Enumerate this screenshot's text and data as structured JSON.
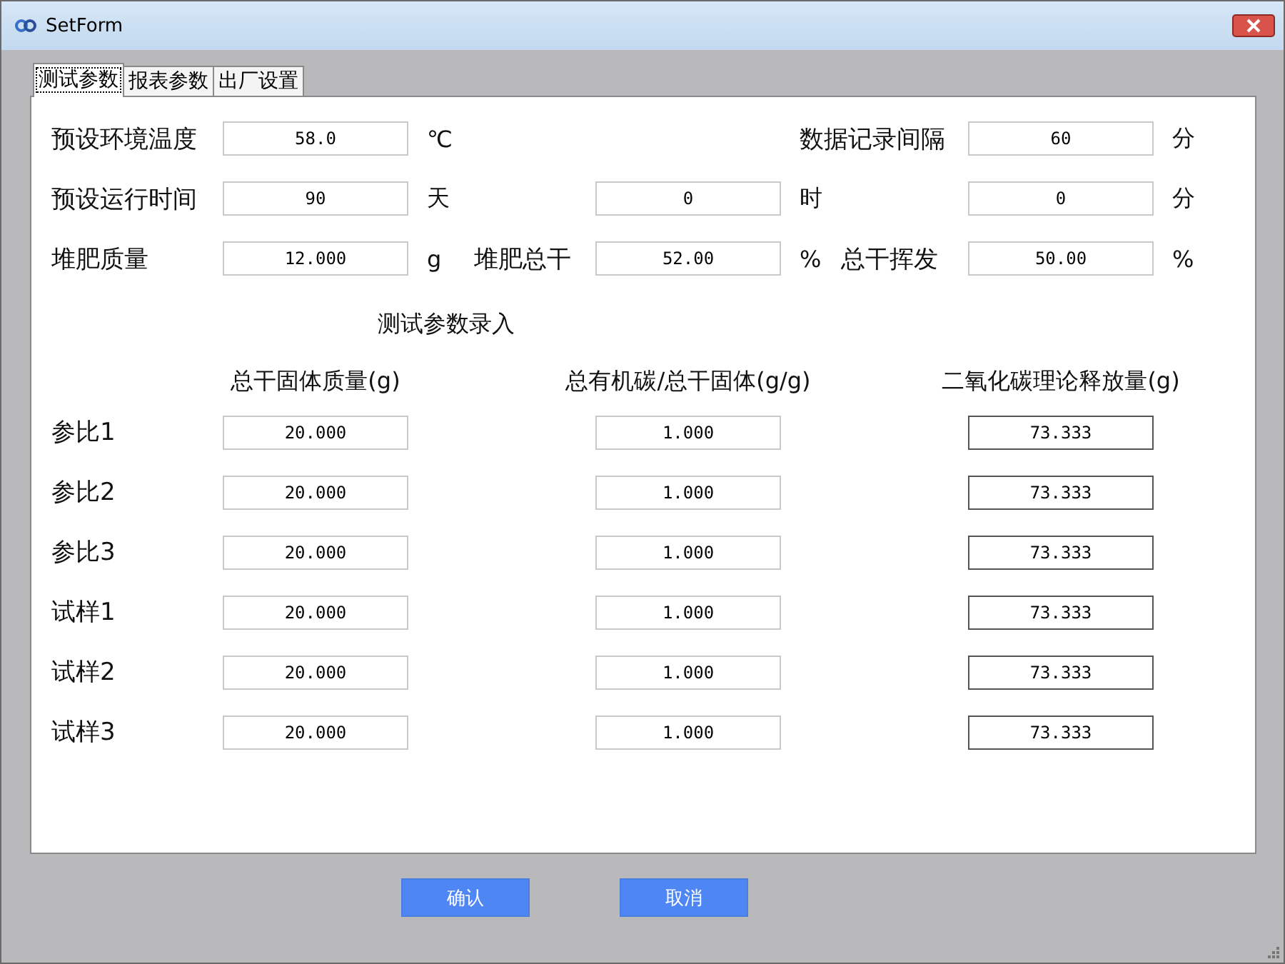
{
  "window": {
    "title": "SetForm"
  },
  "tabs": [
    {
      "label": "测试参数",
      "selected": true
    },
    {
      "label": "报表参数",
      "selected": false
    },
    {
      "label": "出厂设置",
      "selected": false
    }
  ],
  "environment_temperature": {
    "label": "预设环境温度",
    "value": "58.0",
    "unit": "℃"
  },
  "record_interval": {
    "label": "数据记录间隔",
    "value": "60",
    "unit": "分"
  },
  "run_time": {
    "label": "预设运行时间",
    "days": {
      "value": "90",
      "unit": "天"
    },
    "hours": {
      "value": "0",
      "unit": "时"
    },
    "minutes": {
      "value": "0",
      "unit": "分"
    }
  },
  "compost_mass": {
    "label": "堆肥质量",
    "value": "12.000",
    "unit": "g"
  },
  "compost_dry": {
    "label": "堆肥总干",
    "value": "52.00",
    "unit": "%"
  },
  "dry_volatile": {
    "label": "总干挥发",
    "value": "50.00",
    "unit": "%"
  },
  "entry_section": {
    "title": "测试参数录入",
    "columns": [
      {
        "label": "总干固体质量(g)",
        "readonly": false
      },
      {
        "label": "总有机碳/总干固体(g/g)",
        "readonly": false
      },
      {
        "label": "二氧化碳理论释放量(g)",
        "readonly": true
      }
    ],
    "rows": [
      {
        "label": "参比1",
        "values": [
          "20.000",
          "1.000",
          "73.333"
        ]
      },
      {
        "label": "参比2",
        "values": [
          "20.000",
          "1.000",
          "73.333"
        ]
      },
      {
        "label": "参比3",
        "values": [
          "20.000",
          "1.000",
          "73.333"
        ]
      },
      {
        "label": "试样1",
        "values": [
          "20.000",
          "1.000",
          "73.333"
        ]
      },
      {
        "label": "试样2",
        "values": [
          "20.000",
          "1.000",
          "73.333"
        ]
      },
      {
        "label": "试样3",
        "values": [
          "20.000",
          "1.000",
          "73.333"
        ]
      }
    ]
  },
  "buttons": [
    {
      "label": "确认"
    },
    {
      "label": "取消"
    }
  ]
}
